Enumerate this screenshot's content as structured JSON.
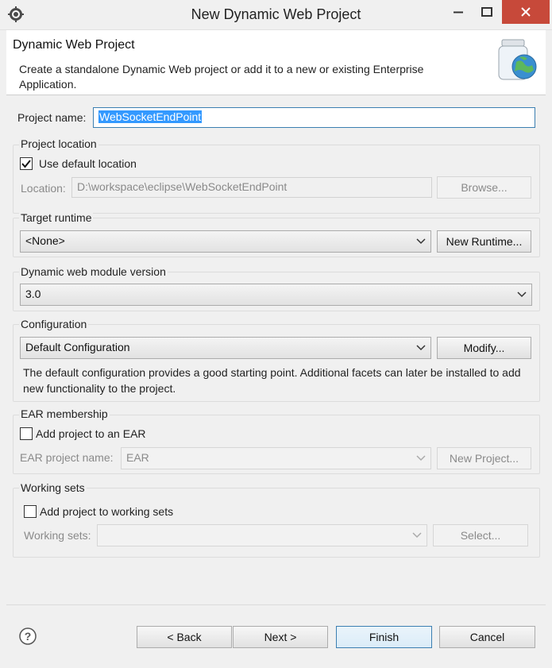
{
  "window": {
    "title": "New Dynamic Web Project"
  },
  "header": {
    "title": "Dynamic Web Project",
    "description": "Create a standalone Dynamic Web project or add it to a new or existing Enterprise Application."
  },
  "project_name": {
    "label": "Project name:",
    "value": "WebSocketEndPoint"
  },
  "project_location": {
    "group_label": "Project location",
    "use_default_label": "Use default location",
    "use_default_checked": true,
    "location_label": "Location:",
    "location_value": "D:\\workspace\\eclipse\\WebSocketEndPoint",
    "browse_label": "Browse..."
  },
  "target_runtime": {
    "group_label": "Target runtime",
    "selected": "<None>",
    "new_runtime_label": "New Runtime..."
  },
  "module_version": {
    "group_label": "Dynamic web module version",
    "selected": "3.0"
  },
  "configuration": {
    "group_label": "Configuration",
    "selected": "Default Configuration",
    "modify_label": "Modify...",
    "description": "The default configuration provides a good starting point. Additional facets can later be installed to add new functionality to the project."
  },
  "ear": {
    "group_label": "EAR membership",
    "add_label": "Add project to an EAR",
    "add_checked": false,
    "project_name_label": "EAR project name:",
    "project_name_value": "EAR",
    "new_project_label": "New Project..."
  },
  "working_sets": {
    "group_label": "Working sets",
    "add_label": "Add project to working sets",
    "add_checked": false,
    "sets_label": "Working sets:",
    "sets_value": "",
    "select_label": "Select..."
  },
  "footer": {
    "back_label": "< Back",
    "next_label": "Next >",
    "finish_label": "Finish",
    "cancel_label": "Cancel"
  },
  "icons": {
    "app": "eclipse-gear-icon",
    "help": "help-icon",
    "header_art": "jar-globe-icon"
  },
  "colors": {
    "close_button": "#c7493a",
    "selection": "#3399ff",
    "focus_border": "#3c7fb1"
  }
}
